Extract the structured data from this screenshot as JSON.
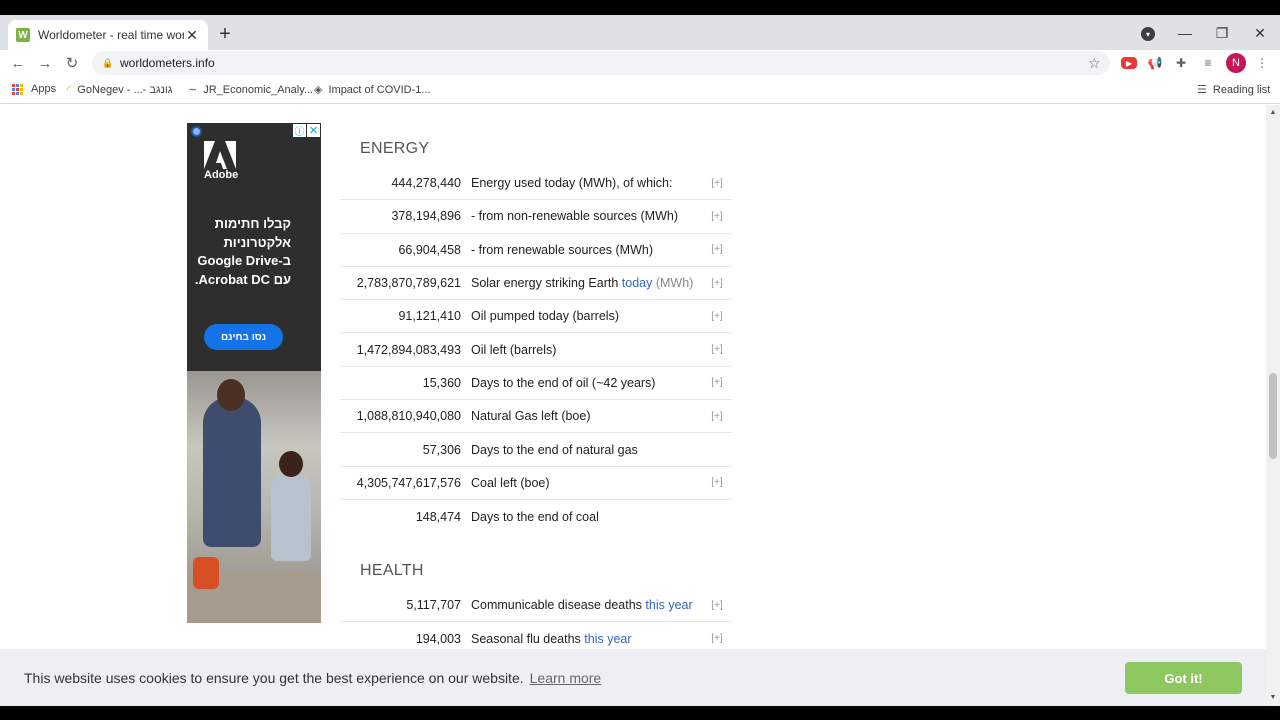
{
  "browser": {
    "tab_title": "Worldometer - real time world st",
    "tab_favicon": "W",
    "new_tab_symbol": "+",
    "url": "worldometers.info",
    "profile_initial": "N"
  },
  "bookmarks": [
    {
      "label": "Apps",
      "icon": "apps-grid-icon"
    },
    {
      "label": "GoNegev - ...- גונגב",
      "icon": "gonegev-icon"
    },
    {
      "label": "JR_Economic_Analy...",
      "icon": "wave-icon"
    },
    {
      "label": "Impact of COVID-1...",
      "icon": "doc-icon"
    }
  ],
  "reading_list": "Reading list",
  "ad": {
    "brand": "Adobe",
    "headline_lines": [
      "קבלו חתימות",
      "אלקטרוניות",
      "ב-Google Drive",
      "עם Acrobat DC."
    ],
    "cta": "נסו בחינם",
    "info_symbol": "ⓘ",
    "close_symbol": "✕"
  },
  "energy": {
    "title": "ENERGY",
    "rows": [
      {
        "value": "444,278,440",
        "label": "Energy used today (MWh), of which:",
        "expand": "[+]"
      },
      {
        "value": "378,194,896",
        "label": "- from non-renewable sources (MWh)",
        "expand": "[+]"
      },
      {
        "value": "66,904,458",
        "label": "- from renewable sources (MWh)",
        "expand": "[+]"
      },
      {
        "value": "2,783,870,789,621",
        "label": "Solar energy striking Earth ",
        "link": "today",
        "suffix": " (MWh)",
        "expand": "[+]"
      },
      {
        "value": "91,121,410",
        "label": "Oil pumped today (barrels)",
        "expand": "[+]"
      },
      {
        "value": "1,472,894,083,493",
        "label": "Oil left (barrels)",
        "expand": "[+]"
      },
      {
        "value": "15,360",
        "label": "Days to the end of oil (~42 years)",
        "expand": "[+]"
      },
      {
        "value": "1,088,810,940,080",
        "label": "Natural Gas left (boe)",
        "expand": "[+]"
      },
      {
        "value": "57,306",
        "label": "Days to the end of natural gas",
        "expand": ""
      },
      {
        "value": "4,305,747,617,576",
        "label": "Coal left (boe)",
        "expand": "[+]"
      },
      {
        "value": "148,474",
        "label": "Days to the end of coal",
        "expand": ""
      }
    ]
  },
  "health": {
    "title": "HEALTH",
    "rows": [
      {
        "value": "5,117,707",
        "label": "Communicable disease deaths ",
        "link": "this year",
        "expand": "[+]"
      },
      {
        "value": "194,003",
        "label": "Seasonal flu deaths ",
        "link": "this year",
        "expand": "[+]"
      }
    ]
  },
  "cookie": {
    "message": "This website uses cookies to ensure you get the best experience on our website.",
    "learn_more": "Learn more",
    "button": "Got it!"
  },
  "colors": {
    "link": "#3366bb",
    "cookie_button": "#8ec760",
    "ad_cta": "#1473e6"
  }
}
